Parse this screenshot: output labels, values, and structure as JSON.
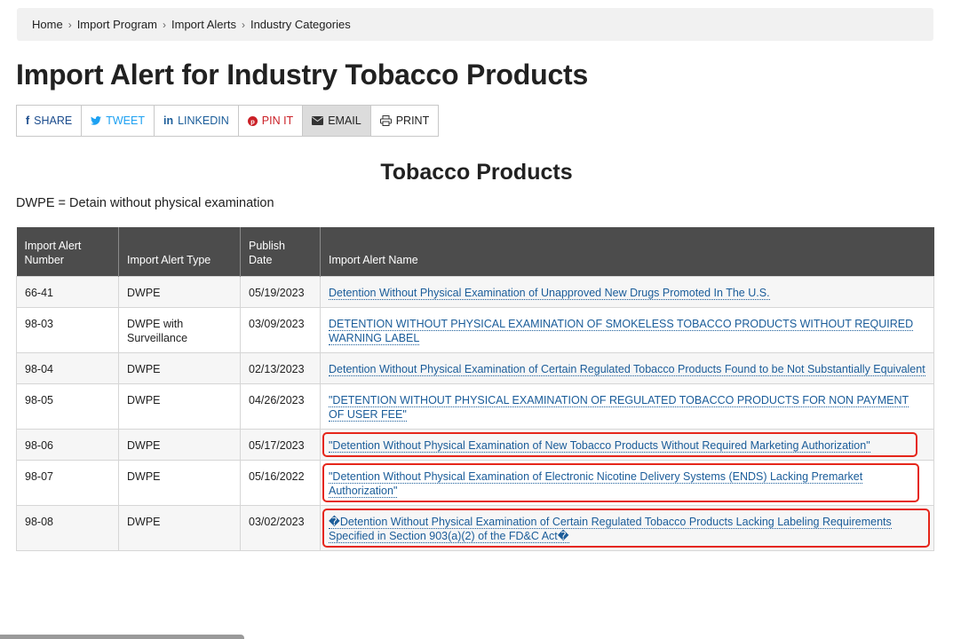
{
  "breadcrumb": {
    "items": [
      "Home",
      "Import Program",
      "Import Alerts",
      "Industry Categories"
    ],
    "separator": ">"
  },
  "page_title": "Import Alert for Industry Tobacco Products",
  "share": {
    "facebook": {
      "label": "SHARE",
      "icon": "f",
      "icon_name": "facebook-icon"
    },
    "twitter": {
      "label": "TWEET",
      "icon": "twitter-bird",
      "icon_name": "twitter-icon"
    },
    "linkedin": {
      "label": "LINKEDIN",
      "icon": "in",
      "icon_name": "linkedin-icon"
    },
    "pinterest": {
      "label": "PIN IT",
      "icon": "pinterest-p",
      "icon_name": "pinterest-icon"
    },
    "email": {
      "label": "EMAIL",
      "icon": "envelope",
      "icon_name": "envelope-icon"
    },
    "print": {
      "label": "PRINT",
      "icon": "printer",
      "icon_name": "print-icon"
    }
  },
  "section_heading": "Tobacco Products",
  "dwpe_note": "DWPE = Detain without physical examination",
  "table": {
    "headers": [
      "Import Alert Number",
      "Import Alert Type",
      "Publish Date",
      "Import Alert Name"
    ],
    "header_lines": [
      [
        "Import Alert",
        "Number"
      ],
      [
        "Import Alert Type"
      ],
      [
        "Publish",
        "Date"
      ],
      [
        "Import Alert Name"
      ]
    ],
    "rows": [
      {
        "number": "66-41",
        "type": "DWPE",
        "date": "05/19/2023",
        "name": "Detention Without Physical Examination of Unapproved New Drugs Promoted In The U.S.",
        "highlighted": false
      },
      {
        "number": "98-03",
        "type": "DWPE with Surveillance",
        "date": "03/09/2023",
        "name": "DETENTION WITHOUT PHYSICAL EXAMINATION OF SMOKELESS TOBACCO PRODUCTS WITHOUT REQUIRED WARNING LABEL",
        "highlighted": false
      },
      {
        "number": "98-04",
        "type": "DWPE",
        "date": "02/13/2023",
        "name": "Detention Without Physical Examination of Certain Regulated Tobacco Products Found to be Not Substantially Equivalent",
        "highlighted": false
      },
      {
        "number": "98-05",
        "type": "DWPE",
        "date": "04/26/2023",
        "name": "\"DETENTION WITHOUT PHYSICAL EXAMINATION OF REGULATED TOBACCO PRODUCTS FOR NON PAYMENT OF USER FEE\"",
        "highlighted": false
      },
      {
        "number": "98-06",
        "type": "DWPE",
        "date": "05/17/2023",
        "name": "\"Detention Without Physical Examination of New Tobacco Products Without Required Marketing Authorization\"",
        "highlighted": true
      },
      {
        "number": "98-07",
        "type": "DWPE",
        "date": "05/16/2022",
        "name": "\"Detention Without Physical Examination of Electronic Nicotine Delivery Systems (ENDS) Lacking Premarket Authorization\"",
        "highlighted": true
      },
      {
        "number": "98-08",
        "type": "DWPE",
        "date": "03/02/2023",
        "name": "�Detention Without Physical Examination of Certain Regulated Tobacco Products Lacking Labeling Requirements Specified in Section 903(a)(2) of the FD&C Act�",
        "highlighted": true
      }
    ]
  },
  "colors": {
    "header_bg": "#4c4c4c",
    "link": "#1a5c99",
    "highlight_border": "#e5261a",
    "breadcrumb_bg": "#f1f1f1"
  }
}
